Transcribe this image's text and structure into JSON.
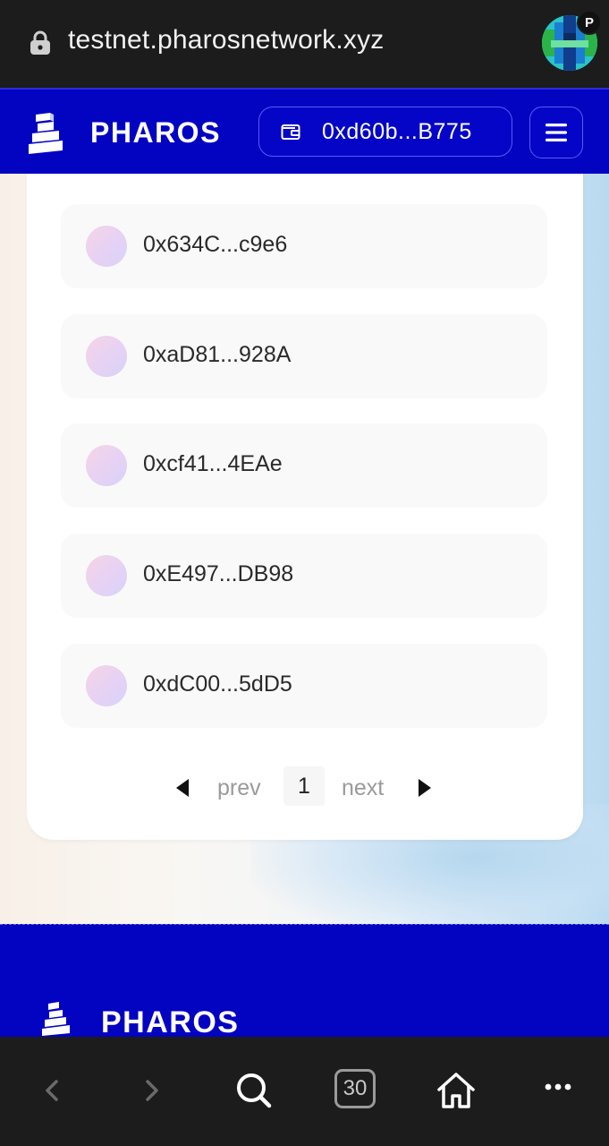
{
  "browser": {
    "url": "testnet.pharosnetwork.xyz",
    "profile_badge": "P",
    "tab_count": "30"
  },
  "header": {
    "brand": "PHAROS",
    "wallet_address": "0xd60b...B775"
  },
  "list": {
    "items": [
      {
        "address": "0x634C...c9e6"
      },
      {
        "address": "0xaD81...928A"
      },
      {
        "address": "0xcf41...4EAe"
      },
      {
        "address": "0xE497...DB98"
      },
      {
        "address": "0xdC00...5dD5"
      }
    ]
  },
  "pagination": {
    "prev_label": "prev",
    "current_page": "1",
    "next_label": "next"
  },
  "footer": {
    "brand": "PHAROS"
  },
  "colors": {
    "brand_blue": "#0303c2",
    "browser_chrome": "#1c1c1c"
  },
  "icons": {
    "url_bar": "lock-icon",
    "wallet": "wallet-icon",
    "menu": "hamburger-menu-icon",
    "nav": [
      "back-arrow-icon",
      "forward-arrow-icon",
      "search-icon",
      "tabs-icon",
      "home-icon",
      "more-dots-icon"
    ]
  }
}
